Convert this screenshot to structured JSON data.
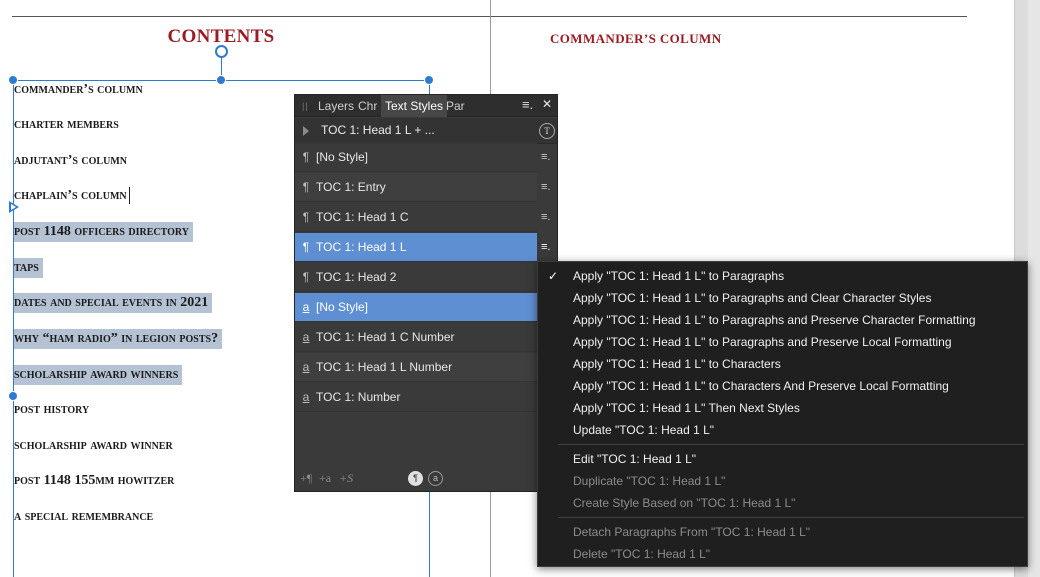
{
  "document": {
    "contents_title": "CONTENTS",
    "right_page_heading": "COMMANDER’S COLUMN",
    "toc_entries": [
      {
        "text": "commander’s column",
        "selected": false
      },
      {
        "text": "charter members",
        "selected": false
      },
      {
        "text": "adjutant’s column",
        "selected": false
      },
      {
        "text": "chaplain’s column",
        "selected": false
      },
      {
        "text": "post 1148 officers directory",
        "selected": true
      },
      {
        "text": "taps",
        "selected": true
      },
      {
        "text": "dates and special events in 2021",
        "selected": true
      },
      {
        "text": "why “ham radio” in legion posts?",
        "selected": true
      },
      {
        "text": "scholarship award winners",
        "selected": true
      },
      {
        "text": "post history",
        "selected": false
      },
      {
        "text": "scholarship award winner",
        "selected": false
      },
      {
        "text": "post 1148 155mm howitzer",
        "selected": false
      },
      {
        "text": "a special remembrance",
        "selected": false
      }
    ]
  },
  "panel": {
    "tabs": [
      "Layers",
      "Chr",
      "Text Styles",
      "Par"
    ],
    "active_tab": "Text Styles",
    "menu_icon": "hamburger-icon",
    "close_icon": "close-icon",
    "current_style": "TOC 1: Head 1 L + ...",
    "styles": [
      {
        "kind": "paragraph",
        "name": "[No Style]",
        "highlighted": false
      },
      {
        "kind": "paragraph",
        "name": "TOC 1: Entry",
        "highlighted": false
      },
      {
        "kind": "paragraph",
        "name": "TOC 1: Head 1 C",
        "highlighted": false
      },
      {
        "kind": "paragraph",
        "name": "TOC 1: Head 1 L",
        "highlighted": true
      },
      {
        "kind": "paragraph",
        "name": "TOC 1: Head 2",
        "highlighted": false
      },
      {
        "kind": "character",
        "name": "[No Style]",
        "highlighted": true
      },
      {
        "kind": "character",
        "name": "TOC 1: Head 1 C Number",
        "highlighted": false
      },
      {
        "kind": "character",
        "name": "TOC 1: Head 1 L Number",
        "highlighted": false
      },
      {
        "kind": "character",
        "name": "TOC 1: Number",
        "highlighted": false
      }
    ],
    "paragraph_glyph": "¶",
    "character_glyph": "a",
    "row_menu_glyph": "≡.",
    "bottom_icons": {
      "add_paragraph": "+¶",
      "add_character": "+a",
      "add_group": "+S",
      "para_circle": "¶",
      "char_circle": "a"
    }
  },
  "context_menu": {
    "items": [
      {
        "label": "Apply \"TOC 1: Head 1 L\" to Paragraphs",
        "checked": true,
        "enabled": true
      },
      {
        "label": "Apply \"TOC 1: Head 1 L\" to Paragraphs and Clear Character Styles",
        "checked": false,
        "enabled": true
      },
      {
        "label": "Apply \"TOC 1: Head 1 L\" to Paragraphs and Preserve Character Formatting",
        "checked": false,
        "enabled": true
      },
      {
        "label": "Apply \"TOC 1: Head 1 L\" to Paragraphs and Preserve Local Formatting",
        "checked": false,
        "enabled": true
      },
      {
        "label": "Apply \"TOC 1: Head 1 L\" to Characters",
        "checked": false,
        "enabled": true
      },
      {
        "label": "Apply \"TOC 1: Head 1 L\" to Characters And Preserve Local Formatting",
        "checked": false,
        "enabled": true
      },
      {
        "label": "Apply \"TOC 1: Head 1 L\" Then Next Styles",
        "checked": false,
        "enabled": true
      },
      {
        "label": "Update \"TOC 1: Head 1 L\"",
        "checked": false,
        "enabled": true
      },
      {
        "label": "Edit \"TOC 1: Head 1 L\"",
        "checked": false,
        "enabled": true
      },
      {
        "label": "Duplicate \"TOC 1: Head 1 L\"",
        "checked": false,
        "enabled": false
      },
      {
        "label": "Create Style Based on \"TOC 1: Head 1 L\"",
        "checked": false,
        "enabled": false
      },
      {
        "label": "Detach Paragraphs From \"TOC 1: Head 1 L\"",
        "checked": false,
        "enabled": false
      },
      {
        "label": "Delete \"TOC 1: Head 1 L\"",
        "checked": false,
        "enabled": false
      }
    ],
    "check_glyph": "✓"
  },
  "colors": {
    "heading_red": "#9b1b22",
    "selection_blue": "#2f7bd0",
    "text_selection": "#b4c2d4",
    "panel_highlight": "#5f8fd3",
    "menu_bg": "#1f1f1f"
  }
}
